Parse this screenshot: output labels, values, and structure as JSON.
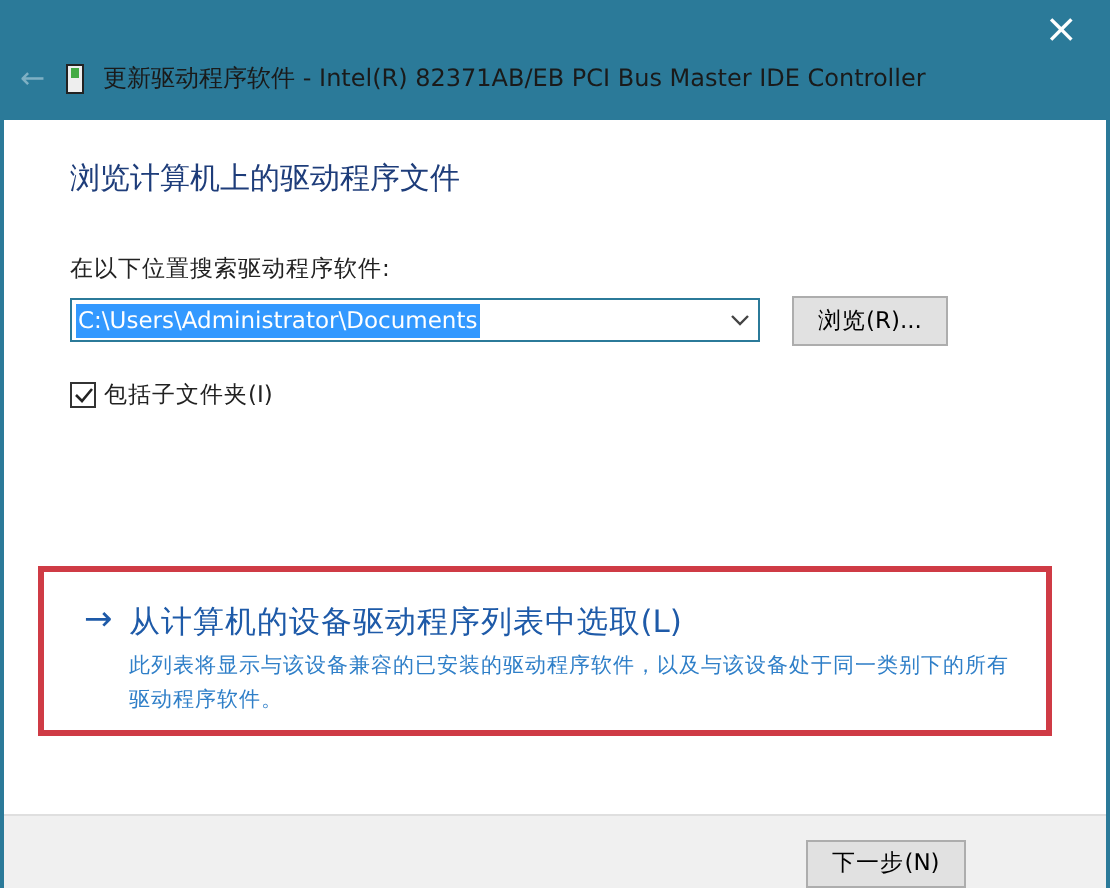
{
  "window": {
    "title": "更新驱动程序软件 - Intel(R) 82371AB/EB PCI Bus Master IDE Controller",
    "close": "×",
    "back": "←"
  },
  "heading": "浏览计算机上的驱动程序文件",
  "search": {
    "label": "在以下位置搜索驱动程序软件:",
    "value": "C:\\Users\\Administrator\\Documents",
    "browse": "浏览(R)..."
  },
  "include_subfolders": {
    "label": "包括子文件夹(I)",
    "checked": true
  },
  "pick_option": {
    "arrow": "→",
    "title": "从计算机的设备驱动程序列表中选取(L)",
    "description": "此列表将显示与该设备兼容的已安装的驱动程序软件，以及与该设备处于同一类别下的所有驱动程序软件。",
    "highlighted": true
  },
  "buttons": [
    "下一步(N)"
  ]
}
